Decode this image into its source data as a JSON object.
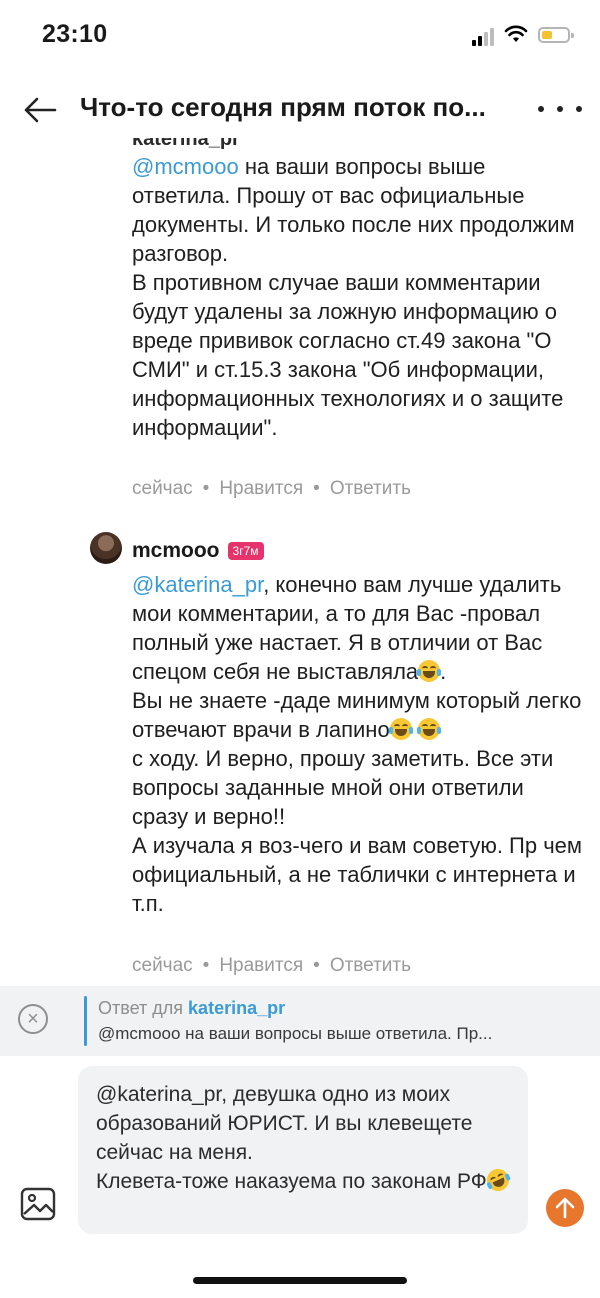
{
  "status_bar": {
    "time": "23:10"
  },
  "header": {
    "title": "Что-то сегодня прям поток по..."
  },
  "comments": [
    {
      "author_clipped": "katerina_pr",
      "mention": "@mcmooo",
      "text": " на ваши вопросы выше ответила. Прошу от вас официальные документы. И только после них продолжим разговор.\nВ противном случае ваши комментарии будут удалены за ложную информацию о вреде прививок согласно ст.49 закона \"О СМИ\" и ст.15.3 закона \"Об информации, информационных технологиях и о защите информации\".",
      "time": "сейчас",
      "like": "Нравится",
      "reply": "Ответить"
    },
    {
      "author": "mcmooo",
      "badge": "3г7м",
      "mention": "@katerina_pr",
      "text_a": ", конечно вам лучше удалить мои комментарии, а то для Вас -провал полный уже настает. Я в отличии от Вас спецом себя не выставляла",
      "text_b": ".\nВы не знаете -даде минимум который легко отвечают врачи в лапино",
      "text_c": " ",
      "text_d": "\nс ходу. И верно, прошу заметить. Все эти вопросы заданные мной они ответили сразу и верно!!\nА изучала я воз-чего и вам советую. Пр чем официальный, а не таблички с интернета и т.п.",
      "time": "сейчас",
      "like": "Нравится",
      "reply": "Ответить"
    }
  ],
  "reply_bar": {
    "label": "Ответ для",
    "to": "katerina_pr",
    "preview": "@mcmooo на ваши вопросы выше ответила. Пр..."
  },
  "composer": {
    "text": "@katerina_pr, девушка одно из моих образований ЮРИСТ. И вы клевещете сейчас на меня.\nКлевета-тоже наказуема по законам РФ"
  },
  "icons": {
    "back": "arrow-left-icon",
    "more": "more-dots-icon",
    "close": "close-circle-icon",
    "image": "image-icon",
    "send": "arrow-up-icon",
    "emoji_laugh": "tears-of-joy-emoji",
    "emoji_rofl": "rolling-laugh-emoji"
  },
  "colors": {
    "mention": "#3a9bd5",
    "badge": "#e6336b",
    "send": "#e8772e"
  }
}
